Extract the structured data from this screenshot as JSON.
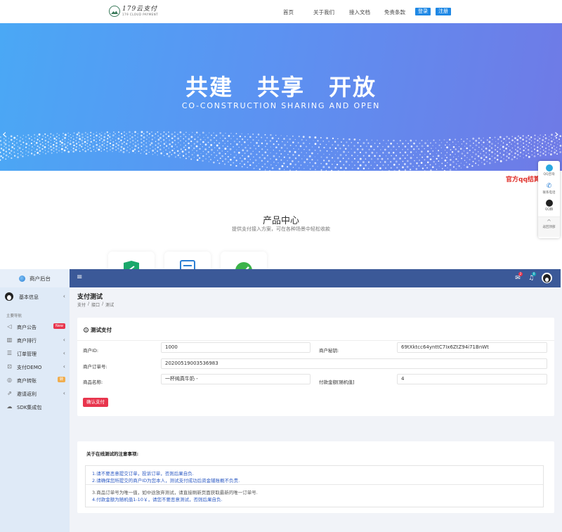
{
  "site": {
    "logo": {
      "cn": "179云支付",
      "en": "179 CLOUD PAYMENT"
    },
    "nav": [
      "首页",
      "关于我们",
      "接入文档",
      "免责条款"
    ],
    "login_label": "登录",
    "register_label": "注册",
    "banner": {
      "title": "共建　共享　开放",
      "subtitle": "CO-CONSTRUCTION SHARING AND OPEN"
    },
    "qq_float_text": "官方qq结算",
    "side_panel": [
      "QQ咨询",
      "联系电话",
      "QQ群",
      "返回顶部"
    ],
    "products": {
      "title": "产品中心",
      "subtitle": "提供支付接入方案，可在各种场景中轻松收款"
    }
  },
  "admin": {
    "sidebar": {
      "title": "商户后台",
      "user_label": "基本信息",
      "section_label": "主要导航",
      "items": [
        {
          "label": "商户公告",
          "badge": "New"
        },
        {
          "label": "商户排行"
        },
        {
          "label": "订单管理"
        },
        {
          "label": "支付DEMO"
        },
        {
          "label": "商户转账",
          "badge": "转"
        },
        {
          "label": "邀请返利"
        },
        {
          "label": "SDK集成包"
        }
      ]
    },
    "topbar": {
      "mail_count": "2",
      "bell_count": "0"
    },
    "page_title": "支付测试",
    "breadcrumb": [
      "支付",
      "/",
      "接口",
      "/",
      "测试"
    ],
    "form": {
      "title": "测试支付",
      "merchant_id_label": "商户ID:",
      "merchant_id_value": "1000",
      "merchant_key_label": "商户秘钥:",
      "merchant_key_value": "69tXktcc64ynttC7Ix6ZtZ94i71BnWt",
      "order_no_label": "商户订单号:",
      "order_no_value": "20200519003536983",
      "product_label": "商品名称:",
      "product_value": "一杯纯真牛奶 -",
      "amount_label": "付款金额[随机值]",
      "amount_value": "4",
      "submit_label": "确认支付"
    },
    "notes": {
      "title": "关于在线测试的注意事项:",
      "lines": [
        "1.请不要恶意提交订单，投诉订单，否则后果自负.",
        "2.请确保您所提交的商户ID为您本人，测试支付成功后资金辅账概不负责.",
        "3.商品订单号为唯一值，如中途放弃测试，请直接刷新页面获取最新的唯一订单号.",
        "4.付款金额为随机值1-10￥，请您不要恶意测试，否则后果自负."
      ]
    }
  },
  "colors": {
    "admin_topbar": "#3b5998",
    "sidebar_bg": "#dfeaf7",
    "nav_button": "#1e88e5",
    "submit_button": "#e8354d",
    "notes_text": "#2b59c3"
  }
}
